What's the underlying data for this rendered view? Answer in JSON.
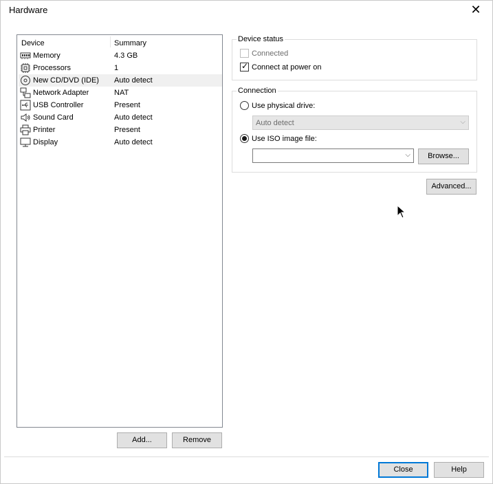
{
  "window": {
    "title": "Hardware"
  },
  "device_list": {
    "columns": {
      "device": "Device",
      "summary": "Summary"
    },
    "rows": [
      {
        "icon": "memory-icon",
        "name": "Memory",
        "summary": "4.3 GB",
        "selected": false
      },
      {
        "icon": "processor-icon",
        "name": "Processors",
        "summary": "1",
        "selected": false
      },
      {
        "icon": "cd-dvd-icon",
        "name": "New CD/DVD (IDE)",
        "summary": "Auto detect",
        "selected": true
      },
      {
        "icon": "network-adapter-icon",
        "name": "Network Adapter",
        "summary": "NAT",
        "selected": false
      },
      {
        "icon": "usb-icon",
        "name": "USB Controller",
        "summary": "Present",
        "selected": false
      },
      {
        "icon": "speaker-icon",
        "name": "Sound Card",
        "summary": "Auto detect",
        "selected": false
      },
      {
        "icon": "printer-icon",
        "name": "Printer",
        "summary": "Present",
        "selected": false
      },
      {
        "icon": "monitor-icon",
        "name": "Display",
        "summary": "Auto detect",
        "selected": false
      }
    ]
  },
  "list_buttons": {
    "add": "Add...",
    "remove": "Remove"
  },
  "device_status": {
    "title": "Device status",
    "connected": {
      "label": "Connected",
      "checked": false,
      "enabled": false
    },
    "connect_at_power_on": {
      "label": "Connect at power on",
      "checked": true,
      "enabled": true
    }
  },
  "connection": {
    "title": "Connection",
    "physical": {
      "label": "Use physical drive:",
      "selected": false,
      "drive_value": "Auto detect"
    },
    "iso": {
      "label": "Use ISO image file:",
      "selected": true,
      "file_value": ""
    },
    "browse": "Browse..."
  },
  "advanced": "Advanced...",
  "footer": {
    "close": "Close",
    "help": "Help"
  }
}
